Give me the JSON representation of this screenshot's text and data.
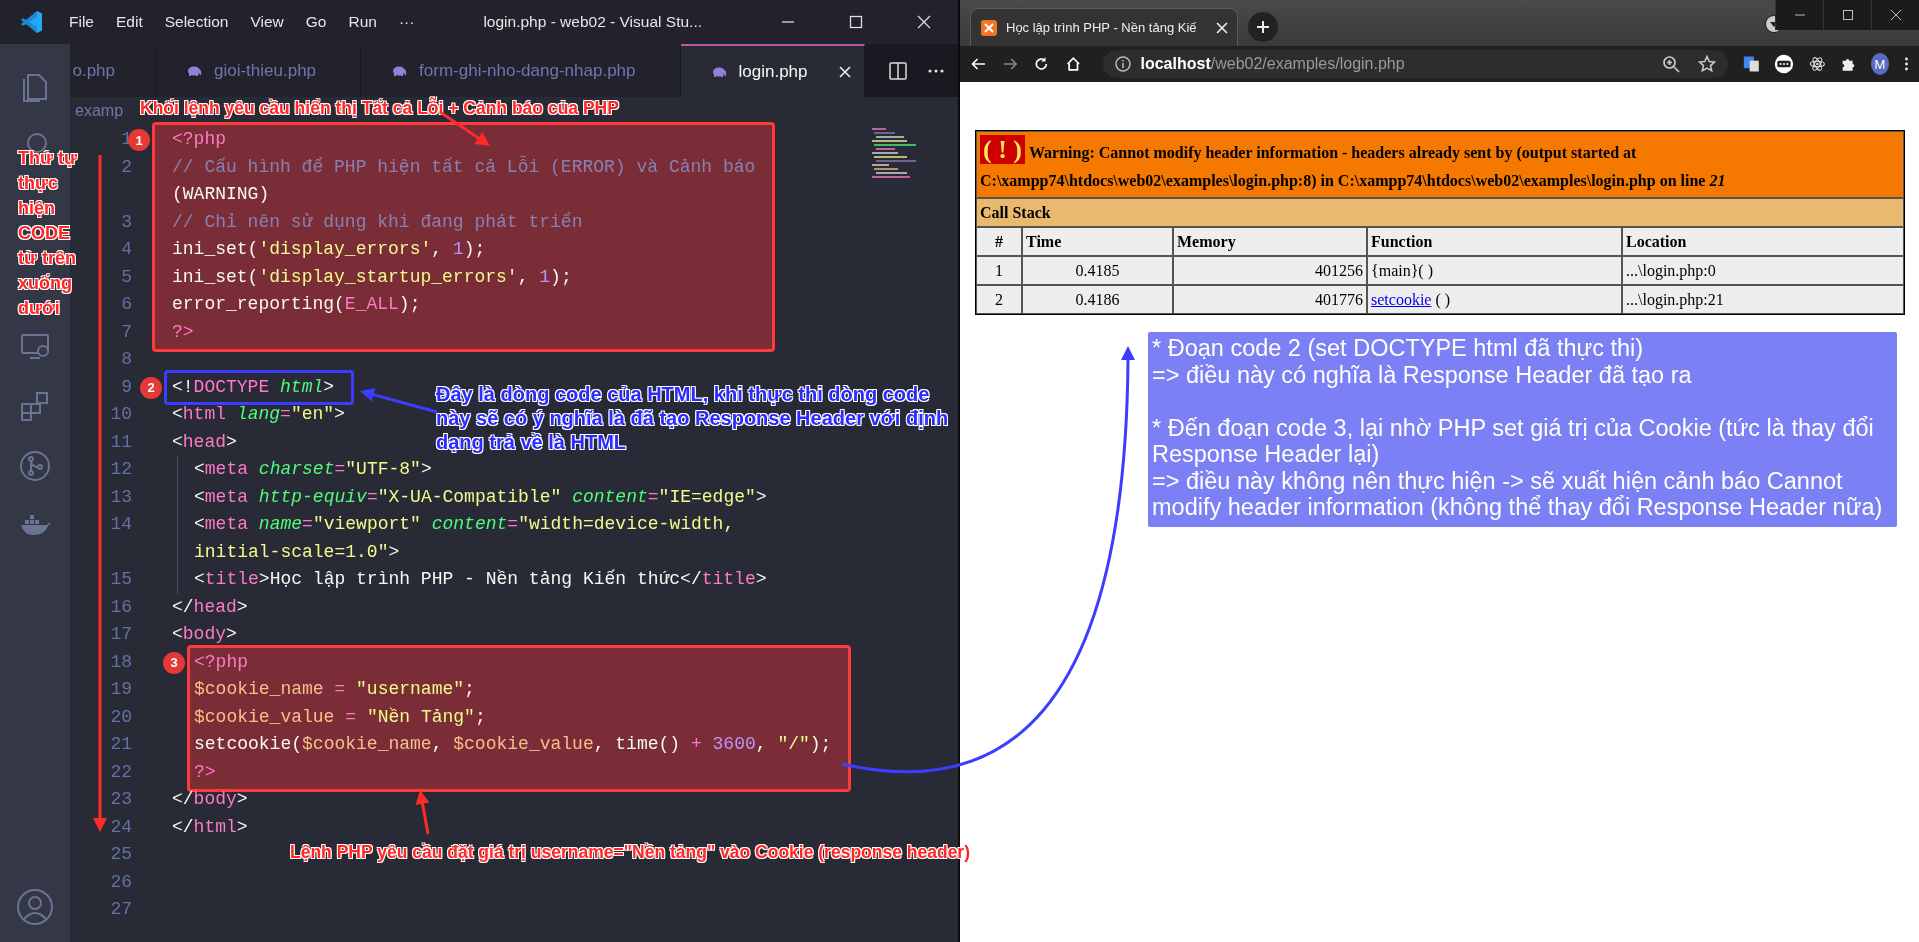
{
  "vscode": {
    "menu": [
      "File",
      "Edit",
      "Selection",
      "View",
      "Go",
      "Run",
      "···"
    ],
    "title": "login.php - web02 - Visual Stu...",
    "tabs": [
      {
        "label": "o.php",
        "selected": false
      },
      {
        "label": "gioi-thieu.php",
        "selected": false
      },
      {
        "label": "form-ghi-nho-dang-nhap.php",
        "selected": false
      },
      {
        "label": "login.php",
        "selected": true
      }
    ],
    "breadcrumb": "examp",
    "blocks": [
      {
        "color": "#ff3a3a",
        "filled": true,
        "marker": "1",
        "lines": [
          {
            "n": "1",
            "indented": false,
            "text": "<?php"
          },
          {
            "n": "2",
            "indented": false,
            "text": "// Cấu hình để PHP hiện tất cả Lỗi (ERROR) và Cảnh báo",
            "continuation": "(WARNING)"
          },
          {
            "n": "3",
            "indented": false,
            "text": "// Chỉ nên sử dụng khi đang phát triển"
          },
          {
            "n": "4",
            "indented": false,
            "text": "ini_set('display_errors', 1);"
          },
          {
            "n": "5",
            "indented": false,
            "text": "ini_set('display_startup_errors', 1);"
          },
          {
            "n": "6",
            "indented": false,
            "text": "error_reporting(E_ALL);"
          },
          {
            "n": "7",
            "indented": false,
            "text": "?>"
          }
        ]
      },
      {
        "lines": [
          {
            "n": "8"
          }
        ]
      },
      {
        "color": "#3d3dff",
        "filled": false,
        "marker": "2",
        "lines": [
          {
            "n": "9",
            "indented": false,
            "text": "<!DOCTYPE html>"
          }
        ]
      },
      {
        "lines": [
          {
            "n": "10",
            "indented": false,
            "text": "<html lang=\"en\">"
          },
          {
            "n": "11",
            "indented": false,
            "text": "<head>"
          },
          {
            "n": "12",
            "indented": true,
            "text": "<meta charset=\"UTF-8\">"
          },
          {
            "n": "13",
            "indented": true,
            "text": "<meta http-equiv=\"X-UA-Compatible\" content=\"IE=edge\">"
          },
          {
            "n": "14",
            "indented": true,
            "text": "<meta name=\"viewport\" content=\"width=device-width,",
            "continuation": "initial-scale=1.0\">"
          },
          {
            "n": "15",
            "indented": true,
            "text": "<title>Học lập trình PHP - Nền tảng Kiến thức</title>"
          },
          {
            "n": "16",
            "indented": false,
            "text": "</head>"
          },
          {
            "n": "17",
            "indented": false,
            "text": "<body>"
          }
        ]
      },
      {
        "color": "#ff3a3a",
        "filled": true,
        "marker": "3",
        "lines": [
          {
            "n": "18",
            "indented": true,
            "text": "<?php"
          },
          {
            "n": "19",
            "indented": true,
            "text": "$cookie_name = \"username\";"
          },
          {
            "n": "20",
            "indented": true,
            "text": "$cookie_value = \"Nền Tảng\";"
          },
          {
            "n": "21",
            "indented": true,
            "text": "setcookie($cookie_name, $cookie_value, time() + 3600, \"/\");"
          },
          {
            "n": "22",
            "indented": true,
            "text": "?>"
          }
        ]
      },
      {
        "lines": [
          {
            "n": "23",
            "indented": false,
            "text": "</body>"
          },
          {
            "n": "24",
            "indented": false,
            "text": "</html>"
          },
          {
            "n": "25"
          },
          {
            "n": "26"
          },
          {
            "n": "27"
          }
        ]
      }
    ]
  },
  "browser": {
    "tab_title": "Học lập trình PHP - Nền tảng Kiế",
    "url_host": "localhost",
    "url_path": "/web02/examples/login.php",
    "avatar": "M",
    "error": {
      "icon": "( ! )",
      "message": "Warning: Cannot modify header information - headers already sent by (output started at C:\\xampp74\\htdocs\\web02\\examples\\login.php:8) in C:\\xampp74\\htdocs\\web02\\examples\\login.php on line *21*",
      "call_stack_title": "Call Stack",
      "columns": [
        "#",
        "Time",
        "Memory",
        "Function",
        "Location"
      ],
      "rows": [
        {
          "n": "1",
          "time": "0.4185",
          "memory": "401256",
          "function": {
            "name": "{main}",
            "link": false,
            "args": "( )"
          },
          "location": "...\\login.php:0"
        },
        {
          "n": "2",
          "time": "0.4186",
          "memory": "401776",
          "function": {
            "name": "setcookie",
            "link": true,
            "args": "( )"
          },
          "location": "...\\login.php:21"
        }
      ]
    },
    "note": {
      "paragraphs": [
        [
          "* Đoạn code 2 (set DOCTYPE html đã thực thi)",
          "=> điều này có nghĩa là Response Header đã tạo ra"
        ],
        [
          "* Đến đoạn code 3, lại nhờ PHP set giá trị của Cookie (tức là thay đổi Response Header lại)",
          "=> điều này không nên thực hiện -> sẽ xuất hiện cảnh báo Cannot modify header information (không thể thay đổi Response Header nữa)"
        ]
      ]
    }
  },
  "annotations": [
    {
      "kind": "top-callout",
      "text": "Khối lệnh yêu cầu hiển thị Tất cả Lỗi + Cảnh báo của PHP"
    },
    {
      "kind": "side-note",
      "text": "Thứ tự thực hiện CODE từ trên xuống dưới"
    },
    {
      "kind": "blue-callout",
      "text": "Đây là dòng code của HTML, khi thực thi dòng code này sẽ có ý nghĩa là đã tạo Response Header với định dạng trả về là HTML"
    },
    {
      "kind": "bottom-callout",
      "text": "Lệnh PHP yêu cầu đặt giá trị username=\"Nền tảng\" vào Cookie (response header)"
    }
  ]
}
